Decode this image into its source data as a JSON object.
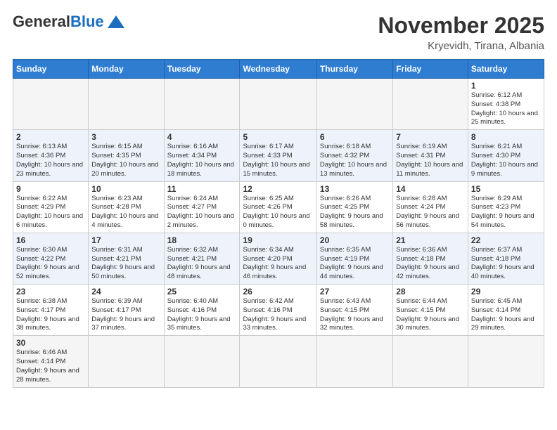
{
  "header": {
    "logo_general": "General",
    "logo_blue": "Blue",
    "month_title": "November 2025",
    "location": "Kryevidh, Tirana, Albania"
  },
  "weekdays": [
    "Sunday",
    "Monday",
    "Tuesday",
    "Wednesday",
    "Thursday",
    "Friday",
    "Saturday"
  ],
  "rows": [
    [
      {
        "day": "",
        "info": ""
      },
      {
        "day": "",
        "info": ""
      },
      {
        "day": "",
        "info": ""
      },
      {
        "day": "",
        "info": ""
      },
      {
        "day": "",
        "info": ""
      },
      {
        "day": "",
        "info": ""
      },
      {
        "day": "1",
        "info": "Sunrise: 6:12 AM\nSunset: 4:38 PM\nDaylight: 10 hours\nand 25 minutes."
      }
    ],
    [
      {
        "day": "2",
        "info": "Sunrise: 6:13 AM\nSunset: 4:36 PM\nDaylight: 10 hours\nand 23 minutes."
      },
      {
        "day": "3",
        "info": "Sunrise: 6:15 AM\nSunset: 4:35 PM\nDaylight: 10 hours\nand 20 minutes."
      },
      {
        "day": "4",
        "info": "Sunrise: 6:16 AM\nSunset: 4:34 PM\nDaylight: 10 hours\nand 18 minutes."
      },
      {
        "day": "5",
        "info": "Sunrise: 6:17 AM\nSunset: 4:33 PM\nDaylight: 10 hours\nand 15 minutes."
      },
      {
        "day": "6",
        "info": "Sunrise: 6:18 AM\nSunset: 4:32 PM\nDaylight: 10 hours\nand 13 minutes."
      },
      {
        "day": "7",
        "info": "Sunrise: 6:19 AM\nSunset: 4:31 PM\nDaylight: 10 hours\nand 11 minutes."
      },
      {
        "day": "8",
        "info": "Sunrise: 6:21 AM\nSunset: 4:30 PM\nDaylight: 10 hours\nand 9 minutes."
      }
    ],
    [
      {
        "day": "9",
        "info": "Sunrise: 6:22 AM\nSunset: 4:29 PM\nDaylight: 10 hours\nand 6 minutes."
      },
      {
        "day": "10",
        "info": "Sunrise: 6:23 AM\nSunset: 4:28 PM\nDaylight: 10 hours\nand 4 minutes."
      },
      {
        "day": "11",
        "info": "Sunrise: 6:24 AM\nSunset: 4:27 PM\nDaylight: 10 hours\nand 2 minutes."
      },
      {
        "day": "12",
        "info": "Sunrise: 6:25 AM\nSunset: 4:26 PM\nDaylight: 10 hours\nand 0 minutes."
      },
      {
        "day": "13",
        "info": "Sunrise: 6:26 AM\nSunset: 4:25 PM\nDaylight: 9 hours\nand 58 minutes."
      },
      {
        "day": "14",
        "info": "Sunrise: 6:28 AM\nSunset: 4:24 PM\nDaylight: 9 hours\nand 56 minutes."
      },
      {
        "day": "15",
        "info": "Sunrise: 6:29 AM\nSunset: 4:23 PM\nDaylight: 9 hours\nand 54 minutes."
      }
    ],
    [
      {
        "day": "16",
        "info": "Sunrise: 6:30 AM\nSunset: 4:22 PM\nDaylight: 9 hours\nand 52 minutes."
      },
      {
        "day": "17",
        "info": "Sunrise: 6:31 AM\nSunset: 4:21 PM\nDaylight: 9 hours\nand 50 minutes."
      },
      {
        "day": "18",
        "info": "Sunrise: 6:32 AM\nSunset: 4:21 PM\nDaylight: 9 hours\nand 48 minutes."
      },
      {
        "day": "19",
        "info": "Sunrise: 6:34 AM\nSunset: 4:20 PM\nDaylight: 9 hours\nand 46 minutes."
      },
      {
        "day": "20",
        "info": "Sunrise: 6:35 AM\nSunset: 4:19 PM\nDaylight: 9 hours\nand 44 minutes."
      },
      {
        "day": "21",
        "info": "Sunrise: 6:36 AM\nSunset: 4:18 PM\nDaylight: 9 hours\nand 42 minutes."
      },
      {
        "day": "22",
        "info": "Sunrise: 6:37 AM\nSunset: 4:18 PM\nDaylight: 9 hours\nand 40 minutes."
      }
    ],
    [
      {
        "day": "23",
        "info": "Sunrise: 6:38 AM\nSunset: 4:17 PM\nDaylight: 9 hours\nand 38 minutes."
      },
      {
        "day": "24",
        "info": "Sunrise: 6:39 AM\nSunset: 4:17 PM\nDaylight: 9 hours\nand 37 minutes."
      },
      {
        "day": "25",
        "info": "Sunrise: 6:40 AM\nSunset: 4:16 PM\nDaylight: 9 hours\nand 35 minutes."
      },
      {
        "day": "26",
        "info": "Sunrise: 6:42 AM\nSunset: 4:16 PM\nDaylight: 9 hours\nand 33 minutes."
      },
      {
        "day": "27",
        "info": "Sunrise: 6:43 AM\nSunset: 4:15 PM\nDaylight: 9 hours\nand 32 minutes."
      },
      {
        "day": "28",
        "info": "Sunrise: 6:44 AM\nSunset: 4:15 PM\nDaylight: 9 hours\nand 30 minutes."
      },
      {
        "day": "29",
        "info": "Sunrise: 6:45 AM\nSunset: 4:14 PM\nDaylight: 9 hours\nand 29 minutes."
      }
    ],
    [
      {
        "day": "30",
        "info": "Sunrise: 6:46 AM\nSunset: 4:14 PM\nDaylight: 9 hours\nand 28 minutes."
      },
      {
        "day": "",
        "info": ""
      },
      {
        "day": "",
        "info": ""
      },
      {
        "day": "",
        "info": ""
      },
      {
        "day": "",
        "info": ""
      },
      {
        "day": "",
        "info": ""
      },
      {
        "day": "",
        "info": ""
      }
    ]
  ]
}
